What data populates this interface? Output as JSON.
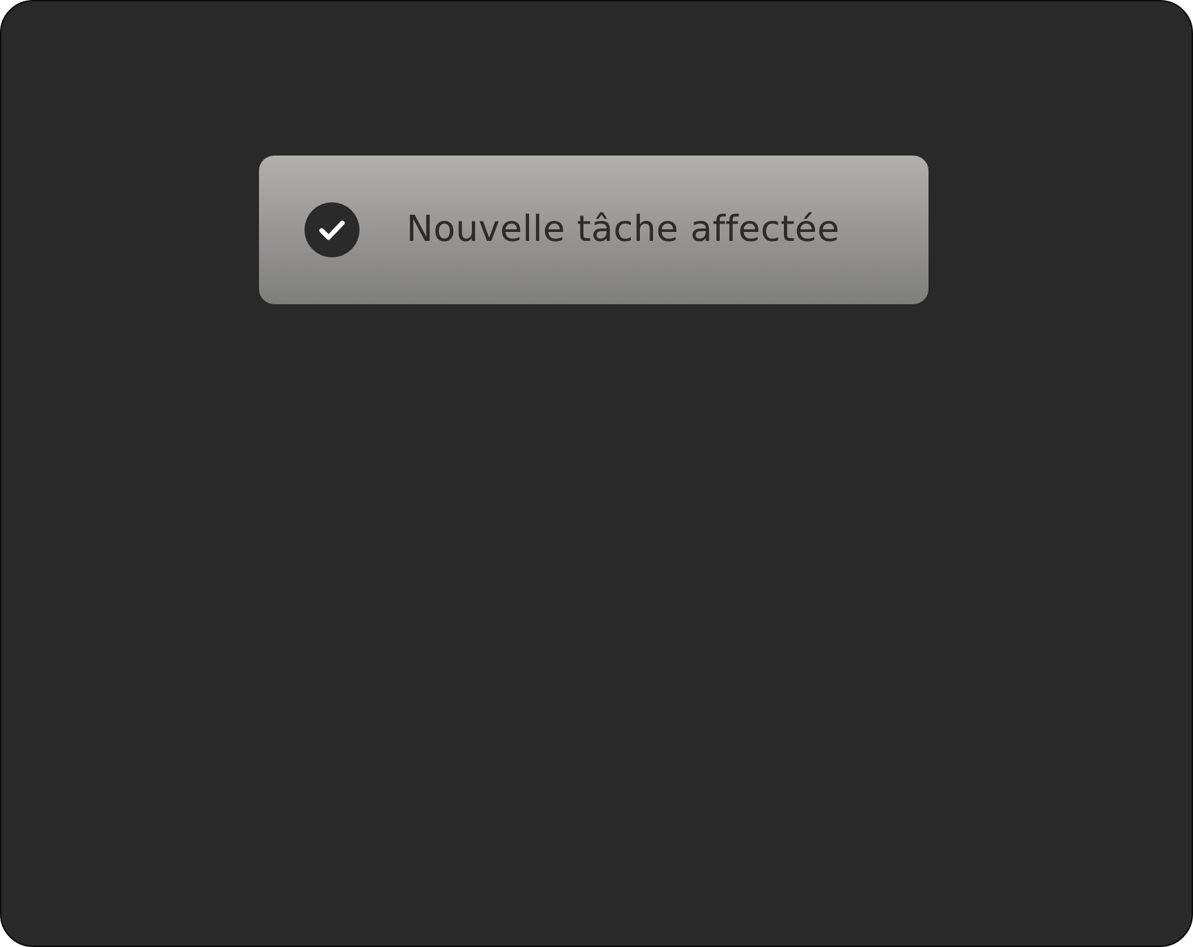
{
  "toast": {
    "kind": "success",
    "message": "Nouvelle tâche affectée"
  }
}
